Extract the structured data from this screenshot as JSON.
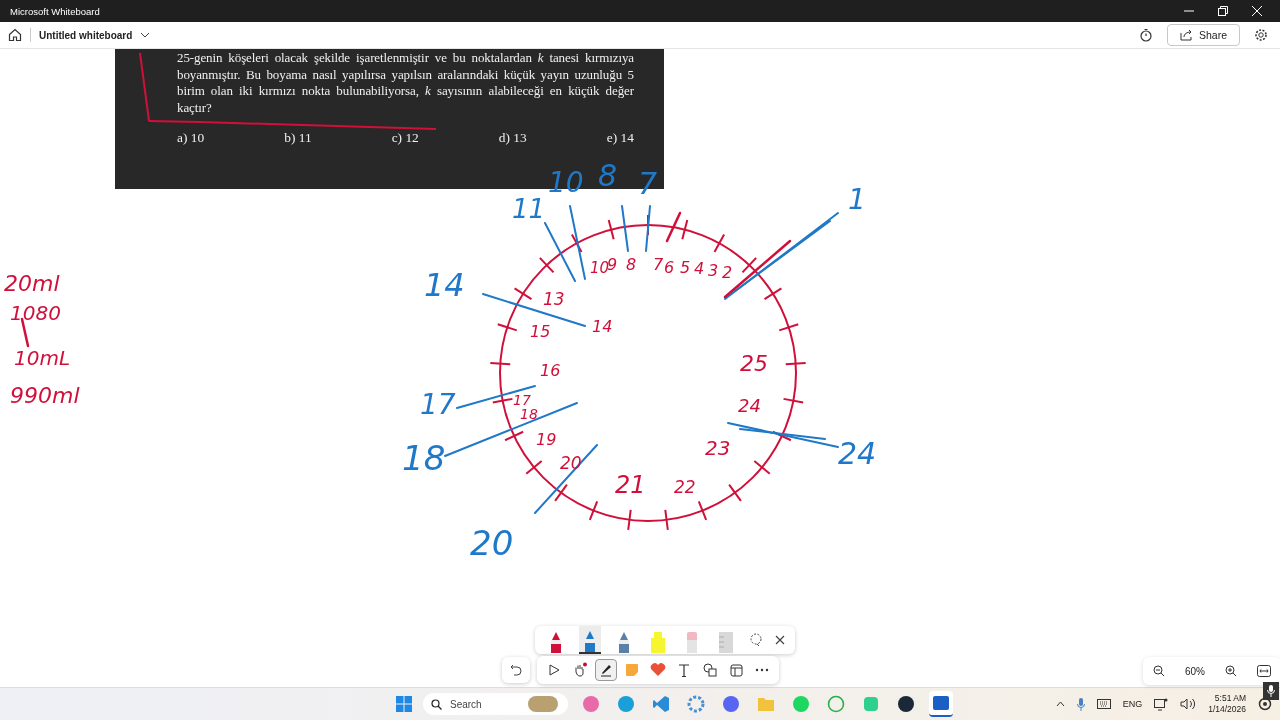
{
  "window": {
    "title": "Microsoft Whiteboard"
  },
  "header": {
    "board_title": "Untitled whiteboard",
    "share_label": "Share"
  },
  "question": {
    "text": "25-genin köşeleri olacak şekilde işaretlenmiştir ve bu noktalardan *k* tanesi kırmızıya boyanmıştır.  Bu boyama nasıl yapılırsa yapılsın aralarındaki küçük yayın uzunluğu 5 birim olan iki kırmızı nokta bulunabiliyorsa, *k* sayısının alabileceği en küçük değer kaçtır?",
    "options": [
      "a) 10",
      "b) 11",
      "c) 12",
      "d) 13",
      "e) 14"
    ]
  },
  "ink_labels": [
    {
      "text": "20ml",
      "color": "#d0103a"
    },
    {
      "text": "1080",
      "color": "#d0103a"
    },
    {
      "text": "10mL",
      "color": "#d0103a"
    },
    {
      "text": "990ml",
      "color": "#d0103a"
    },
    {
      "text": "10",
      "color": "#1f78c8"
    },
    {
      "text": "8",
      "color": "#1f78c8"
    },
    {
      "text": "7",
      "color": "#1f78c8"
    },
    {
      "text": "1",
      "color": "#1f78c8"
    },
    {
      "text": "11",
      "color": "#1f78c8"
    },
    {
      "text": "14",
      "color": "#1f78c8"
    },
    {
      "text": "17",
      "color": "#1f78c8"
    },
    {
      "text": "18",
      "color": "#1f78c8"
    },
    {
      "text": "20",
      "color": "#1f78c8"
    },
    {
      "text": "24",
      "color": "#1f78c8"
    },
    {
      "text": "10",
      "color": "#d0103a"
    },
    {
      "text": "9",
      "color": "#d0103a"
    },
    {
      "text": "8",
      "color": "#d0103a"
    },
    {
      "text": "7",
      "color": "#d0103a"
    },
    {
      "text": "6",
      "color": "#d0103a"
    },
    {
      "text": "5",
      "color": "#d0103a"
    },
    {
      "text": "4",
      "color": "#d0103a"
    },
    {
      "text": "3",
      "color": "#d0103a"
    },
    {
      "text": "2",
      "color": "#d0103a"
    },
    {
      "text": "13",
      "color": "#d0103a"
    },
    {
      "text": "14",
      "color": "#d0103a"
    },
    {
      "text": "15",
      "color": "#d0103a"
    },
    {
      "text": "16",
      "color": "#d0103a"
    },
    {
      "text": "17",
      "color": "#d0103a"
    },
    {
      "text": "18",
      "color": "#d0103a"
    },
    {
      "text": "19",
      "color": "#d0103a"
    },
    {
      "text": "20",
      "color": "#d0103a"
    },
    {
      "text": "21",
      "color": "#d0103a"
    },
    {
      "text": "22",
      "color": "#d0103a"
    },
    {
      "text": "23",
      "color": "#d0103a"
    },
    {
      "text": "24",
      "color": "#d0103a"
    },
    {
      "text": "25",
      "color": "#d0103a"
    }
  ],
  "pen_tray": [
    {
      "kind": "pen",
      "color": "#d0103a",
      "selected": false
    },
    {
      "kind": "pen",
      "color": "#1f78c8",
      "selected": true
    },
    {
      "kind": "pen",
      "color": "#5a7fa8",
      "selected": false
    },
    {
      "kind": "highlighter",
      "color": "#f5f530",
      "selected": false
    },
    {
      "kind": "eraser",
      "color": "#f0b8c0",
      "selected": false
    },
    {
      "kind": "ruler",
      "color": "#d8d8d8",
      "selected": false
    }
  ],
  "tools": [
    {
      "kind": "select",
      "selected": false
    },
    {
      "kind": "hand",
      "selected": false
    },
    {
      "kind": "ink",
      "selected": true
    },
    {
      "kind": "note",
      "selected": false
    },
    {
      "kind": "reaction",
      "selected": false
    },
    {
      "kind": "text",
      "selected": false
    },
    {
      "kind": "shapes",
      "selected": false
    },
    {
      "kind": "template",
      "selected": false
    },
    {
      "kind": "more",
      "selected": false
    }
  ],
  "zoom": {
    "value": "60%"
  },
  "taskbar": {
    "search_placeholder": "Search",
    "apps": [
      {
        "kind": "copilot",
        "selected": false
      },
      {
        "kind": "edge",
        "selected": false
      },
      {
        "kind": "vscode",
        "selected": false
      },
      {
        "kind": "gear",
        "selected": false
      },
      {
        "kind": "discord",
        "selected": false
      },
      {
        "kind": "folder",
        "selected": false
      },
      {
        "kind": "spotify",
        "selected": false
      },
      {
        "kind": "whatsapp",
        "selected": false
      },
      {
        "kind": "bot",
        "selected": false
      },
      {
        "kind": "steam",
        "selected": false
      },
      {
        "kind": "whiteboard",
        "selected": true
      }
    ],
    "language": "ENG",
    "time": "5:51 AM",
    "date": "1/14/2026"
  }
}
